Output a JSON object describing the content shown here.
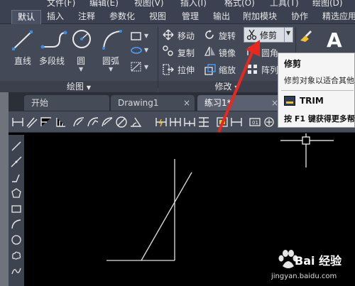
{
  "menu": {
    "items": [
      "文件(F)",
      "编辑(E)",
      "视图(V)",
      "插入(I)",
      "格式(O)",
      "工具(T)",
      "绘图(D)"
    ]
  },
  "ribbon_tabs": [
    {
      "label": "默认",
      "active": true
    },
    {
      "label": "插入"
    },
    {
      "label": "注释"
    },
    {
      "label": "参数化"
    },
    {
      "label": "视图"
    },
    {
      "label": "管理"
    },
    {
      "label": "输出"
    },
    {
      "label": "附加模块"
    },
    {
      "label": "协作"
    },
    {
      "label": "精选应用"
    }
  ],
  "draw_panel": {
    "title": "绘图",
    "line": "直线",
    "polyline": "多段线",
    "circle": "圆",
    "arc": "圆弧"
  },
  "modify_panel": {
    "title": "修改",
    "move": "移动",
    "rotate": "旋转",
    "trim": "修剪",
    "copy": "复制",
    "mirror": "镜像",
    "fillet": "圆角",
    "stretch": "拉伸",
    "scale": "缩放",
    "array": "阵列"
  },
  "tooltip": {
    "title": "修剪",
    "description": "修剪对象以适合其他",
    "command": "TRIM",
    "help": "按 F1 键获得更多帮"
  },
  "doc_tabs": [
    {
      "label": "开始",
      "active": false,
      "closable": false
    },
    {
      "label": "Drawing1",
      "active": false,
      "closable": true
    },
    {
      "label": "练习1*",
      "active": true,
      "closable": true
    }
  ],
  "close_glyph": "×",
  "watermark": {
    "brand": "Bai",
    "brand2": "经验",
    "url": "jingyan.baidu.com"
  },
  "colors": {
    "ribbon_bg": "#434957",
    "canvas_bg": "#000000",
    "annotation_arrow": "#e8281e",
    "tooltip_bg": "#f5f5f5"
  }
}
